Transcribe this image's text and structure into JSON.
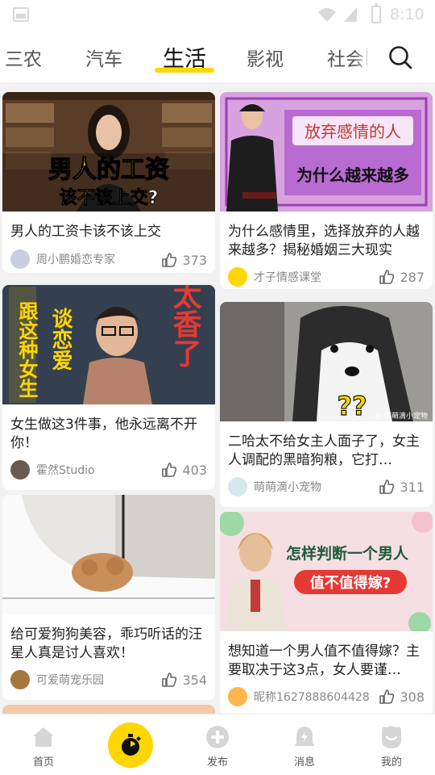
{
  "status_bar": {
    "time": "8:10"
  },
  "tabs": [
    {
      "label": "三农"
    },
    {
      "label": "汽车"
    },
    {
      "label": "生活",
      "active": true
    },
    {
      "label": "影视"
    },
    {
      "label": "社会"
    }
  ],
  "thumbnails": {
    "c1": {
      "line1": "男人的工资",
      "line2": "该不该上交?"
    },
    "c2": {
      "line1": "放弃感情的人",
      "line2": "为什么越来越多"
    },
    "c3": {
      "left_text": "跟这种女生",
      "mid_text": "谈恋爱",
      "right_text": "太香了"
    },
    "c5": {
      "watermark": "@ 萌萌滴小宠物",
      "mark": "??"
    },
    "c6": {
      "line1": "怎样判断一个男人",
      "line2": "值不值得嫁?"
    }
  },
  "cards": [
    {
      "title": "男人的工资卡该不该上交",
      "author": "周小鹏婚恋专家",
      "likes": "373"
    },
    {
      "title": "为什么感情里，选择放弃的人越来越多？揭秘婚姻三大现实",
      "author": "才子情感课堂",
      "likes": "287"
    },
    {
      "title": "女生做这3件事，他永远离不开你！",
      "author": "霍然Studio",
      "likes": "403"
    },
    {
      "title": "二哈太不给女主人面子了，女主人调配的黑暗狗粮，它打…",
      "author": "萌萌滴小宠物",
      "likes": "311"
    },
    {
      "title": "给可爱狗狗美容，乖巧听话的汪星人真是讨人喜欢！",
      "author": "可爱萌宠乐园",
      "likes": "354"
    },
    {
      "title": "想知道一个男人值不值得嫁？主要取决于这3点，女人要谨…",
      "author": "昵称1627888604428",
      "likes": "308"
    }
  ],
  "bottom_nav": [
    {
      "label": "首页",
      "icon": "home-icon"
    },
    {
      "label": "",
      "icon": "camera-icon"
    },
    {
      "label": "发布",
      "icon": "plus-icon"
    },
    {
      "label": "消息",
      "icon": "bell-icon"
    },
    {
      "label": "我的",
      "icon": "profile-icon"
    }
  ],
  "colors": {
    "accent": "#ffd600",
    "background": "#f2f2f2"
  }
}
